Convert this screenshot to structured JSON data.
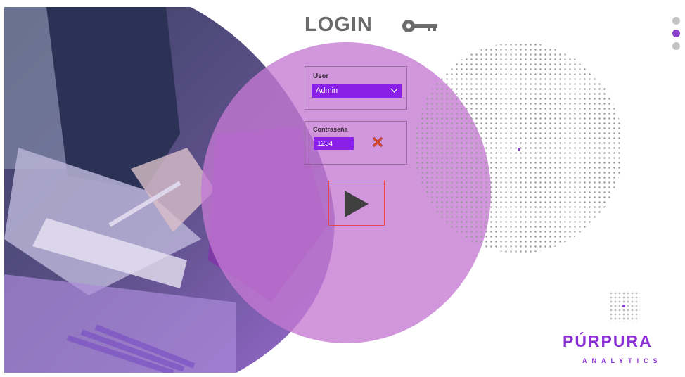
{
  "login": {
    "title": "LOGIN"
  },
  "user_field": {
    "label": "User",
    "selected": "Admin"
  },
  "password_field": {
    "label": "Contraseña",
    "value": "1234"
  },
  "brand": {
    "name": "PÚRPURA",
    "tagline": "ANALYTICS"
  },
  "nav": {
    "dots": 3,
    "active_index": 1
  },
  "colors": {
    "accent": "#8a20e8",
    "circle": "#c478d2",
    "title": "#6b6b6b",
    "play_border": "#e0494f",
    "brand": "#8a2fd6"
  },
  "icons": [
    "key-icon",
    "chevron-down-icon",
    "clear-x-icon",
    "play-icon"
  ]
}
